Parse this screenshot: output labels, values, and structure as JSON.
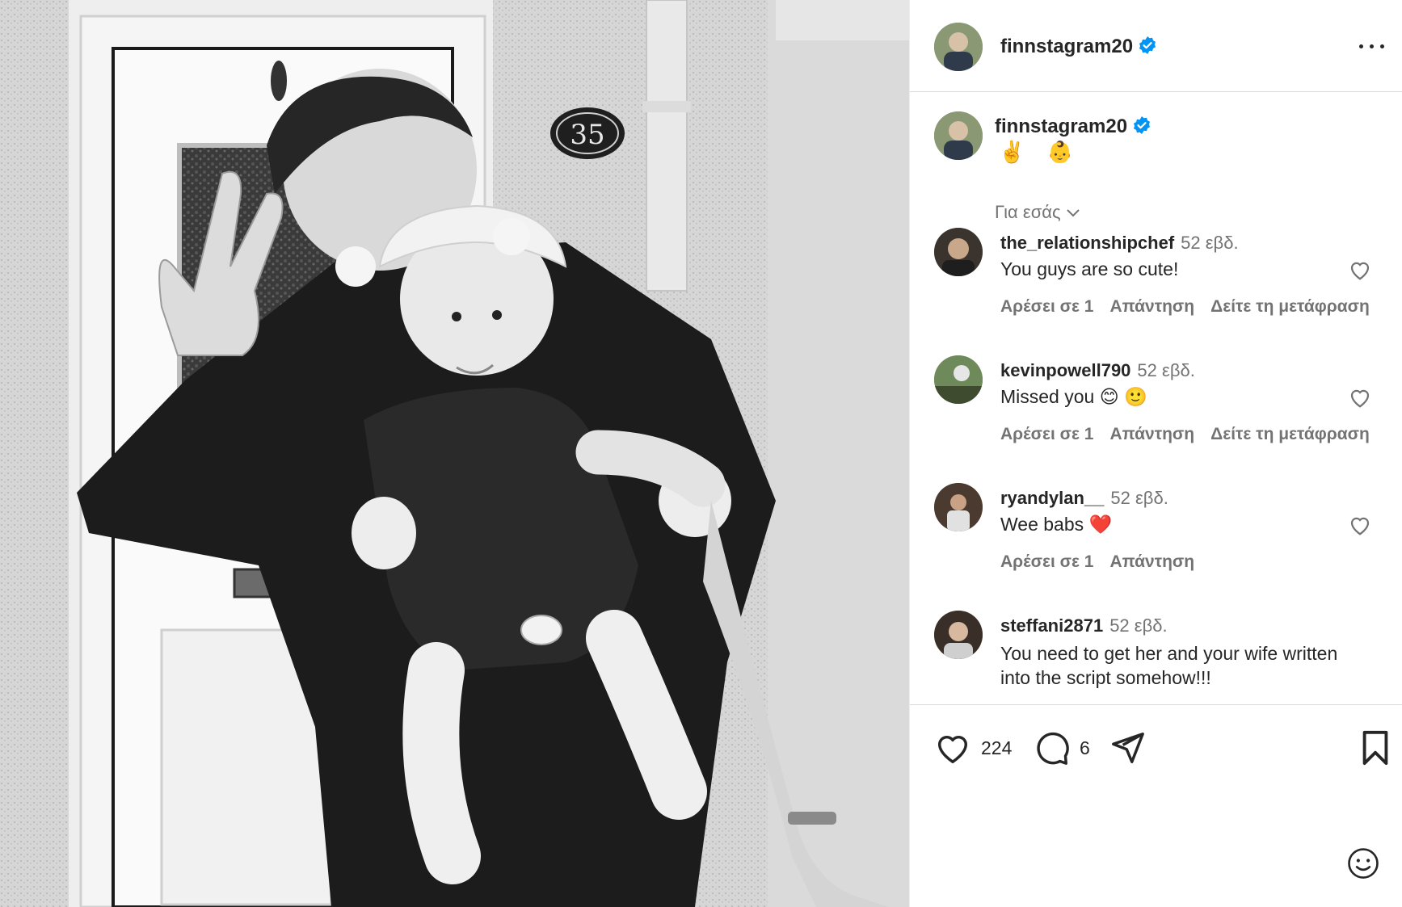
{
  "post": {
    "author": "finnstagram20",
    "caption": "✌️ 👶",
    "for_you_label": "Για εσάς",
    "photo_house_number": "35"
  },
  "comments": [
    {
      "user": "the_relationshipchef",
      "time": "52 εβδ.",
      "text": "You guys are so cute!",
      "likes_label": "Αρέσει σε 1",
      "reply_label": "Απάντηση",
      "translate_label": "Δείτε τη μετάφραση"
    },
    {
      "user": "kevinpowell790",
      "time": "52 εβδ.",
      "text": "Missed you 😊 🙂",
      "likes_label": "Αρέσει σε 1",
      "reply_label": "Απάντηση",
      "translate_label": "Δείτε τη μετάφραση"
    },
    {
      "user": "ryandylan__",
      "time": "52 εβδ.",
      "text": "Wee babs ❤️",
      "likes_label": "Αρέσει σε 1",
      "reply_label": "Απάντηση"
    },
    {
      "user": "steffani2871",
      "time": "52 εβδ.",
      "text": "You need to get her and your wife written into the script somehow!!!"
    }
  ],
  "stats": {
    "likes": "224",
    "comments": "6"
  },
  "colors": {
    "verified": "#0095f6",
    "heart_emoji": "#ed4956",
    "text": "#262626",
    "secondary": "#737373"
  }
}
